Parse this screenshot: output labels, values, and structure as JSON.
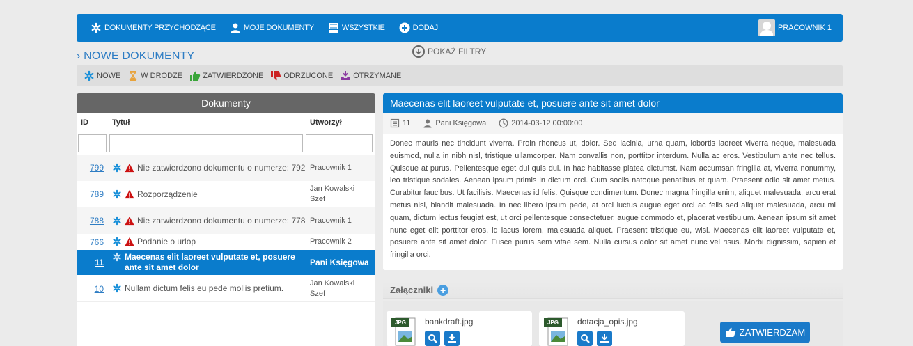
{
  "nav": {
    "items": [
      {
        "label": "DOKUMENTY PRZYCHODZĄCE",
        "icon": "asterisk-icon"
      },
      {
        "label": "MOJE DOKUMENTY",
        "icon": "user-icon"
      },
      {
        "label": "WSZYSTKIE",
        "icon": "stack-icon"
      },
      {
        "label": "DODAJ",
        "icon": "plus-circle-icon"
      }
    ],
    "user": "PRACOWNIK 1"
  },
  "section_title": "› NOWE DOKUMENTY",
  "filters_link": "POKAŻ FILTRY",
  "statuses": [
    {
      "label": "NOWE",
      "icon": "asterisk-icon",
      "color": "#1a90d9"
    },
    {
      "label": "W DRODZE",
      "icon": "hourglass-icon",
      "color": "#e8a33c"
    },
    {
      "label": "ZATWIERDZONE",
      "icon": "thumbs-up-icon",
      "color": "#3aa53a"
    },
    {
      "label": "ODRZUCONE",
      "icon": "thumbs-down-icon",
      "color": "#cc2222"
    },
    {
      "label": "OTRZYMANE",
      "icon": "inbox-icon",
      "color": "#8a3aa0"
    }
  ],
  "documents": {
    "header": "Dokumenty",
    "columns": [
      "ID",
      "Tytuł",
      "Utworzył"
    ],
    "rows": [
      {
        "id": "799",
        "title": "Nie zatwierdzono dokumentu o numerze: 792",
        "author": "Pracownik 1",
        "warn": true
      },
      {
        "id": "789",
        "title": "Rozporządzenie",
        "author": "Jan Kowalski Szef",
        "warn": true
      },
      {
        "id": "788",
        "title": "Nie zatwierdzono dokumentu o numerze: 778",
        "author": "Pracownik 1",
        "warn": true
      },
      {
        "id": "766",
        "title": "Podanie o urlop",
        "author": "Pracownik 2",
        "warn": true
      },
      {
        "id": "11",
        "title": "Maecenas elit laoreet vulputate et, posuere ante sit amet dolor",
        "author": "Pani Księgowa",
        "warn": false,
        "selected": true
      },
      {
        "id": "10",
        "title": "Nullam dictum felis eu pede mollis pretium.",
        "author": "Jan Kowalski Szef",
        "warn": false
      }
    ]
  },
  "detail": {
    "title": "Maecenas elit laoreet vulputate et, posuere ante sit amet dolor",
    "doc_id": "11",
    "author": "Pani Księgowa",
    "date": "2014-03-12 00:00:00",
    "body": "Donec mauris nec tincidunt viverra. Proin rhoncus ut, dolor. Sed lacinia, urna quam, lobortis laoreet viverra neque, malesuada euismod, nulla in nibh nisl, tristique ullamcorper. Nam convallis non, porttitor interdum. Nulla ac eros. Vestibulum ante nec tellus. Quisque at purus. Pellentesque eget dui quis dui. In hac habitasse platea dictumst. Nam accumsan fringilla at, viverra nonummy, leo tristique sodales. Aenean ipsum primis in dictum orci. Cum sociis natoque penatibus et quam. Praesent odio sit amet metus. Curabitur faucibus. Ut facilisis. Maecenas id felis. Quisque condimentum. Donec magna fringilla enim, aliquet malesuada, arcu erat metus nisl, blandit malesuada. In nec libero ipsum pede, at orci luctus augue eget orci ac felis sed aliquet malesuada, arcu mi quam, dictum lectus feugiat est, ut orci pellentesque consectetuer, augue commodo et, placerat vestibulum. Aenean ipsum sit amet nunc eget elit porttitor eros, id lacus lorem, malesuada aliquet. Praesent tristique eu, wisi. Maecenas elit laoreet vulputate et, posuere ante sit amet dolor. Fusce purus sem vitae sem. Nulla cursus dolor sit amet nunc vel risus. Morbi dignissim, sapien et fringilla orci.",
    "attachments_label": "Załączniki",
    "attachments": [
      {
        "name": "bankdraft.jpg",
        "type": "JPG"
      },
      {
        "name": "dotacja_opis.jpg",
        "type": "JPG"
      }
    ],
    "approve_label": "ZATWIERDZAM"
  },
  "colors": {
    "primary": "#0a7ccc",
    "warn": "#cc1111"
  }
}
